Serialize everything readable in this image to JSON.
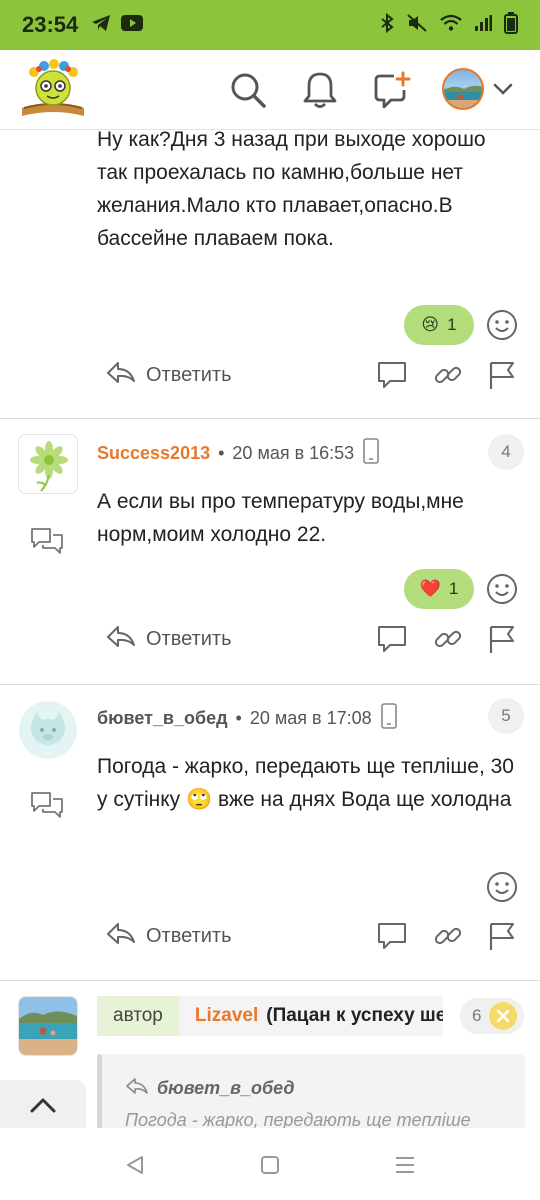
{
  "status_bar": {
    "time": "23:54",
    "icons": [
      "telegram-icon",
      "youtube-icon",
      "bluetooth-icon",
      "mute-icon",
      "wifi-icon",
      "signal-icon",
      "battery-icon"
    ]
  },
  "header": {
    "icons": [
      "search-icon",
      "bell-icon",
      "new-post-icon",
      "user-avatar",
      "chevron-down-icon"
    ]
  },
  "comments": [
    {
      "text": "Ну как?Дня 3 назад при выходе хорошо так проехалась по камню,больше нет желания.Мало кто плавает,опасно.В бассейне плаваем пока.",
      "reaction": {
        "emoji": "😢",
        "count": "1"
      },
      "reply_label": "Ответить"
    },
    {
      "index": "4",
      "user": "Success2013",
      "user_color": "#e8782a",
      "date": "20 мая в 16:53",
      "text": "А если вы про температуру воды,мне норм,моим холодно 22.",
      "reaction": {
        "emoji": "❤️",
        "count": "1"
      },
      "reply_label": "Ответить"
    },
    {
      "index": "5",
      "user": "бювет_в_обед",
      "user_color": "#555555",
      "date": "20 мая в 17:08",
      "text": "Погода - жарко, передають ще тепліше, 30 у сутінку 🙄 вже на днях Вода ще холодна",
      "reply_label": "Ответить"
    },
    {
      "index": "6",
      "author_tag": "автор",
      "user": "Lizavel",
      "user_desc": "(Пацан к успеху шел)",
      "quote_user": "бювет_в_обед",
      "quote_text": "Погода - жарко, передають ще тепліше"
    }
  ],
  "separator": "•",
  "colors": {
    "accent": "#8cc43c",
    "reaction": "#b3dc7a",
    "username": "#e8782a",
    "close_badge": "#f5d96b"
  }
}
